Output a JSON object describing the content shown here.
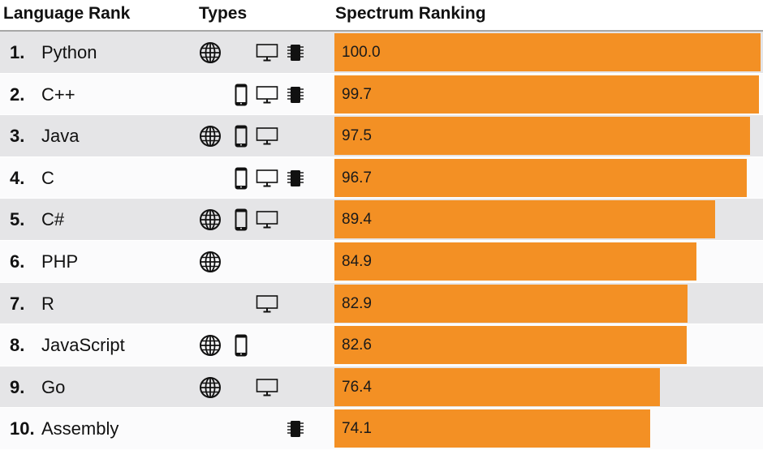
{
  "header": {
    "rank_label": "Language Rank",
    "types_label": "Types",
    "spectrum_label": "Spectrum Ranking"
  },
  "colors": {
    "bar": "#f39024",
    "row_odd": "#e5e5e7",
    "row_even": "#fbfbfc"
  },
  "icons": {
    "web": "globe-icon",
    "mobile": "smartphone-icon",
    "enterprise": "desktop-monitor-icon",
    "embedded": "chip-icon"
  },
  "chart_data": {
    "type": "bar",
    "orientation": "horizontal",
    "title": "Spectrum Ranking",
    "xlabel": "",
    "ylabel": "Language Rank",
    "xlim": [
      0,
      100
    ],
    "grid": false,
    "categories": [
      "Python",
      "C++",
      "Java",
      "C",
      "C#",
      "PHP",
      "R",
      "JavaScript",
      "Go",
      "Assembly"
    ],
    "values": [
      100.0,
      99.7,
      97.5,
      96.7,
      89.4,
      84.9,
      82.9,
      82.6,
      76.4,
      74.1
    ],
    "value_labels": [
      "100.0",
      "99.7",
      "97.5",
      "96.7",
      "89.4",
      "84.9",
      "82.9",
      "82.6",
      "76.4",
      "74.1"
    ]
  },
  "rows": [
    {
      "rank": "1.",
      "name": "Python",
      "score": "100.0",
      "value": 100.0,
      "types": [
        "web",
        "enterprise",
        "embedded"
      ]
    },
    {
      "rank": "2.",
      "name": "C++",
      "score": "99.7",
      "value": 99.7,
      "types": [
        "mobile",
        "enterprise",
        "embedded"
      ]
    },
    {
      "rank": "3.",
      "name": "Java",
      "score": "97.5",
      "value": 97.5,
      "types": [
        "web",
        "mobile",
        "enterprise"
      ]
    },
    {
      "rank": "4.",
      "name": "C",
      "score": "96.7",
      "value": 96.7,
      "types": [
        "mobile",
        "enterprise",
        "embedded"
      ]
    },
    {
      "rank": "5.",
      "name": "C#",
      "score": "89.4",
      "value": 89.4,
      "types": [
        "web",
        "mobile",
        "enterprise"
      ]
    },
    {
      "rank": "6.",
      "name": "PHP",
      "score": "84.9",
      "value": 84.9,
      "types": [
        "web"
      ]
    },
    {
      "rank": "7.",
      "name": "R",
      "score": "82.9",
      "value": 82.9,
      "types": [
        "enterprise"
      ]
    },
    {
      "rank": "8.",
      "name": "JavaScript",
      "score": "82.6",
      "value": 82.6,
      "types": [
        "web",
        "mobile"
      ]
    },
    {
      "rank": "9.",
      "name": "Go",
      "score": "76.4",
      "value": 76.4,
      "types": [
        "web",
        "enterprise"
      ]
    },
    {
      "rank": "10.",
      "name": "Assembly",
      "score": "74.1",
      "value": 74.1,
      "types": [
        "embedded"
      ]
    }
  ]
}
